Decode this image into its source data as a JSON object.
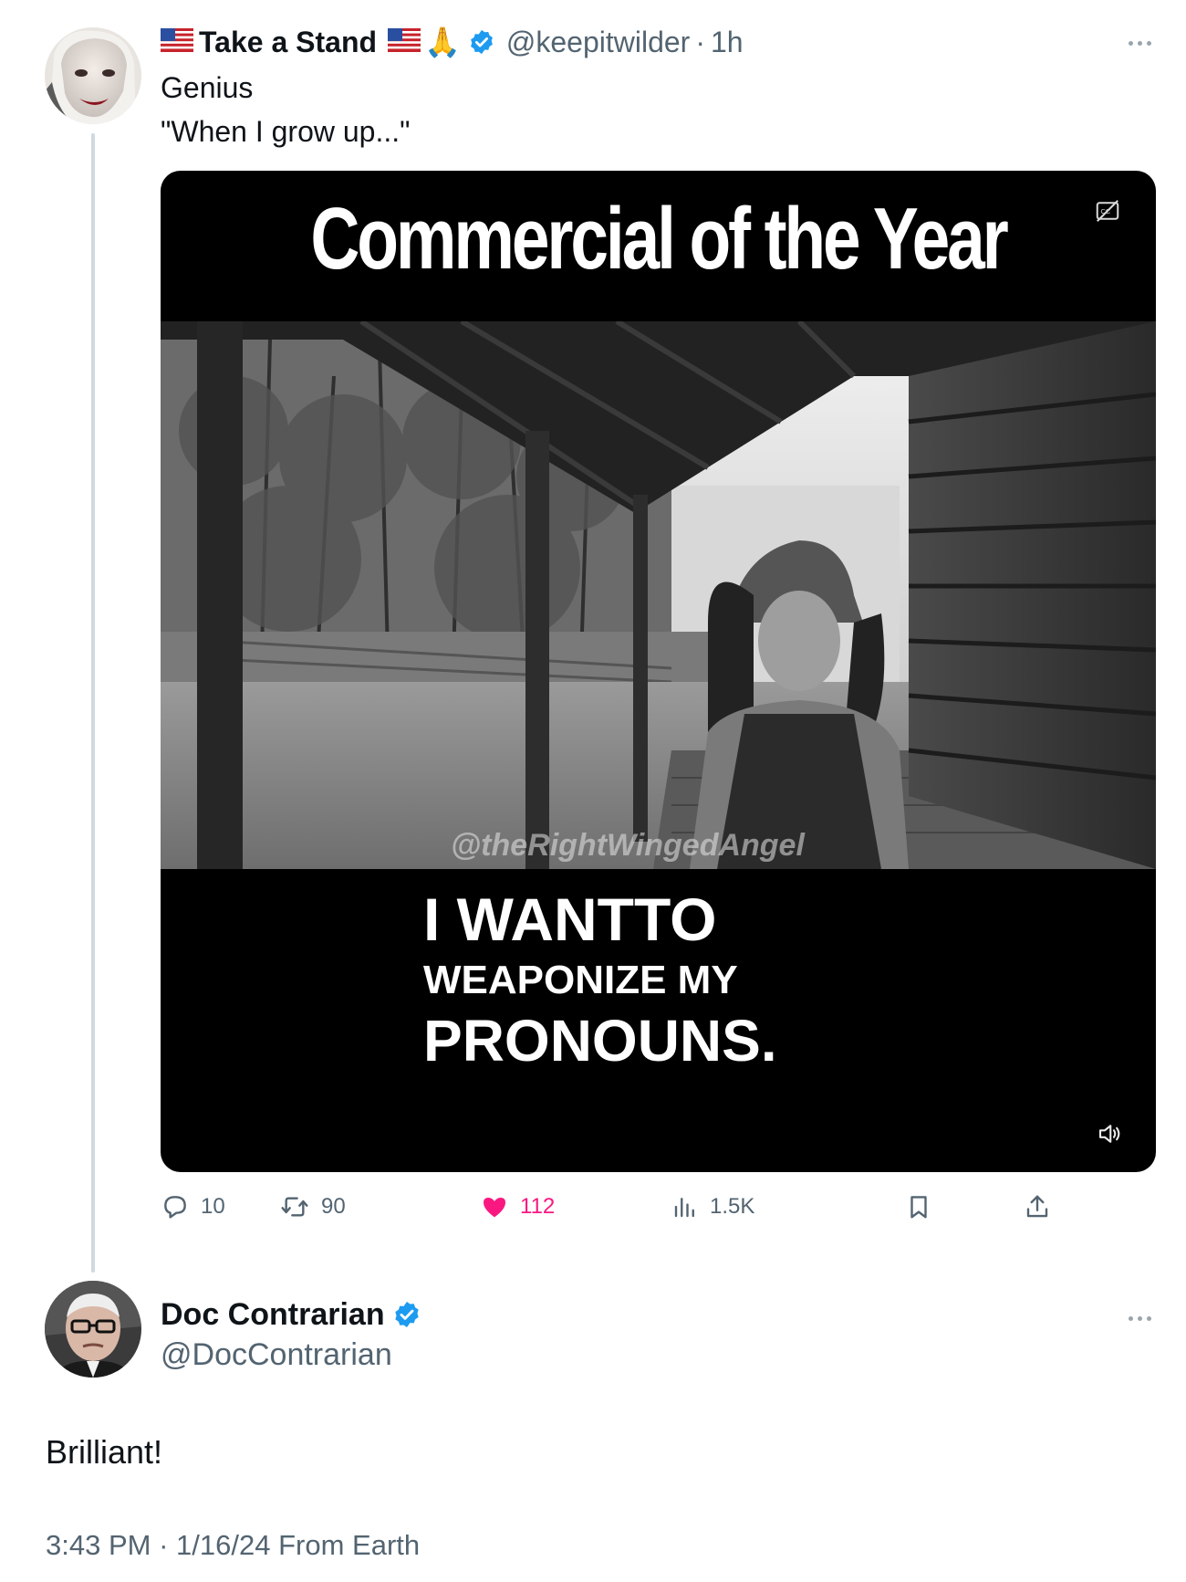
{
  "thread": {
    "original": {
      "display_name": "Take a Stand",
      "name_emoji_after": "🙏",
      "handle": "@keepitwilder",
      "separator": "·",
      "time": "1h",
      "text_line1": "Genius",
      "text_line2": "\"When I grow up...\"",
      "media": {
        "title": "Commercial of the Year",
        "watermark": "@theRightWingedAngel",
        "caption_line1": "I WANTTO",
        "caption_line2": "WEAPONIZE MY",
        "caption_line3": "PRONOUNS."
      },
      "actions": {
        "replies": "10",
        "reposts": "90",
        "likes": "112",
        "views": "1.5K"
      }
    },
    "reply": {
      "display_name": "Doc Contrarian",
      "handle": "@DocContrarian",
      "text": "Brilliant!",
      "time": "3:43 PM",
      "separator": "·",
      "date": "1/16/24",
      "location": "From Earth"
    }
  },
  "colors": {
    "verified": "#1d9bf0",
    "like": "#f91880",
    "muted": "#536471",
    "thread_line": "#cfd9de"
  },
  "icons": [
    "us-flag-icon",
    "verified-badge-icon",
    "more-icon",
    "captions-icon",
    "volume-icon",
    "reply-icon",
    "repost-icon",
    "like-icon",
    "views-icon",
    "bookmark-icon",
    "share-icon"
  ]
}
